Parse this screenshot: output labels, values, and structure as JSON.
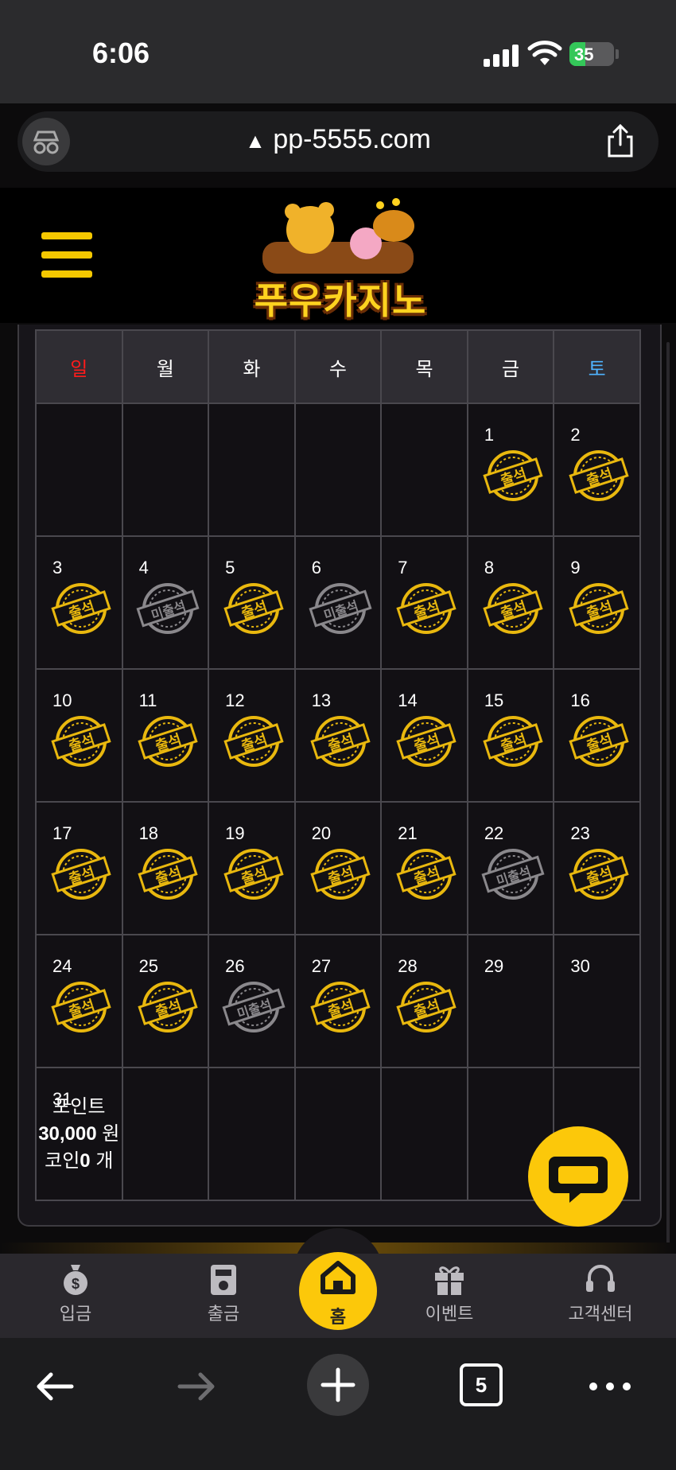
{
  "status": {
    "time": "6:06",
    "battery": "35"
  },
  "browser": {
    "url": "pp-5555.com",
    "tab_count": "5"
  },
  "app": {
    "logo_text": "푸우카지노"
  },
  "calendar": {
    "weekdays": [
      "일",
      "월",
      "화",
      "수",
      "목",
      "금",
      "토"
    ],
    "days": {
      "d1": "1",
      "d2": "2",
      "d3": "3",
      "d4": "4",
      "d5": "5",
      "d6": "6",
      "d7": "7",
      "d8": "8",
      "d9": "9",
      "d10": "10",
      "d11": "11",
      "d12": "12",
      "d13": "13",
      "d14": "14",
      "d15": "15",
      "d16": "16",
      "d17": "17",
      "d18": "18",
      "d19": "19",
      "d20": "20",
      "d21": "21",
      "d22": "22",
      "d23": "23",
      "d24": "24",
      "d25": "25",
      "d26": "26",
      "d27": "27",
      "d28": "28",
      "d29": "29",
      "d30": "30",
      "d31": "31"
    },
    "stamp_attended": "출석",
    "stamp_absent": "미출석",
    "colors": {
      "attended": "#e9b80e",
      "absent": "#8a888c"
    }
  },
  "summary": {
    "points_label": "포인트",
    "points_value": "30,000",
    "points_unit": "원",
    "coin_label": "코인",
    "coin_value": "0",
    "coin_unit": "개"
  },
  "bottom_nav": {
    "deposit": "입금",
    "withdraw": "출금",
    "home": "홈",
    "event": "이벤트",
    "support": "고객센터"
  },
  "theme": {
    "accent": "#fcc80a",
    "sunday": "#ff1b1b",
    "saturday": "#4fb3ff"
  }
}
